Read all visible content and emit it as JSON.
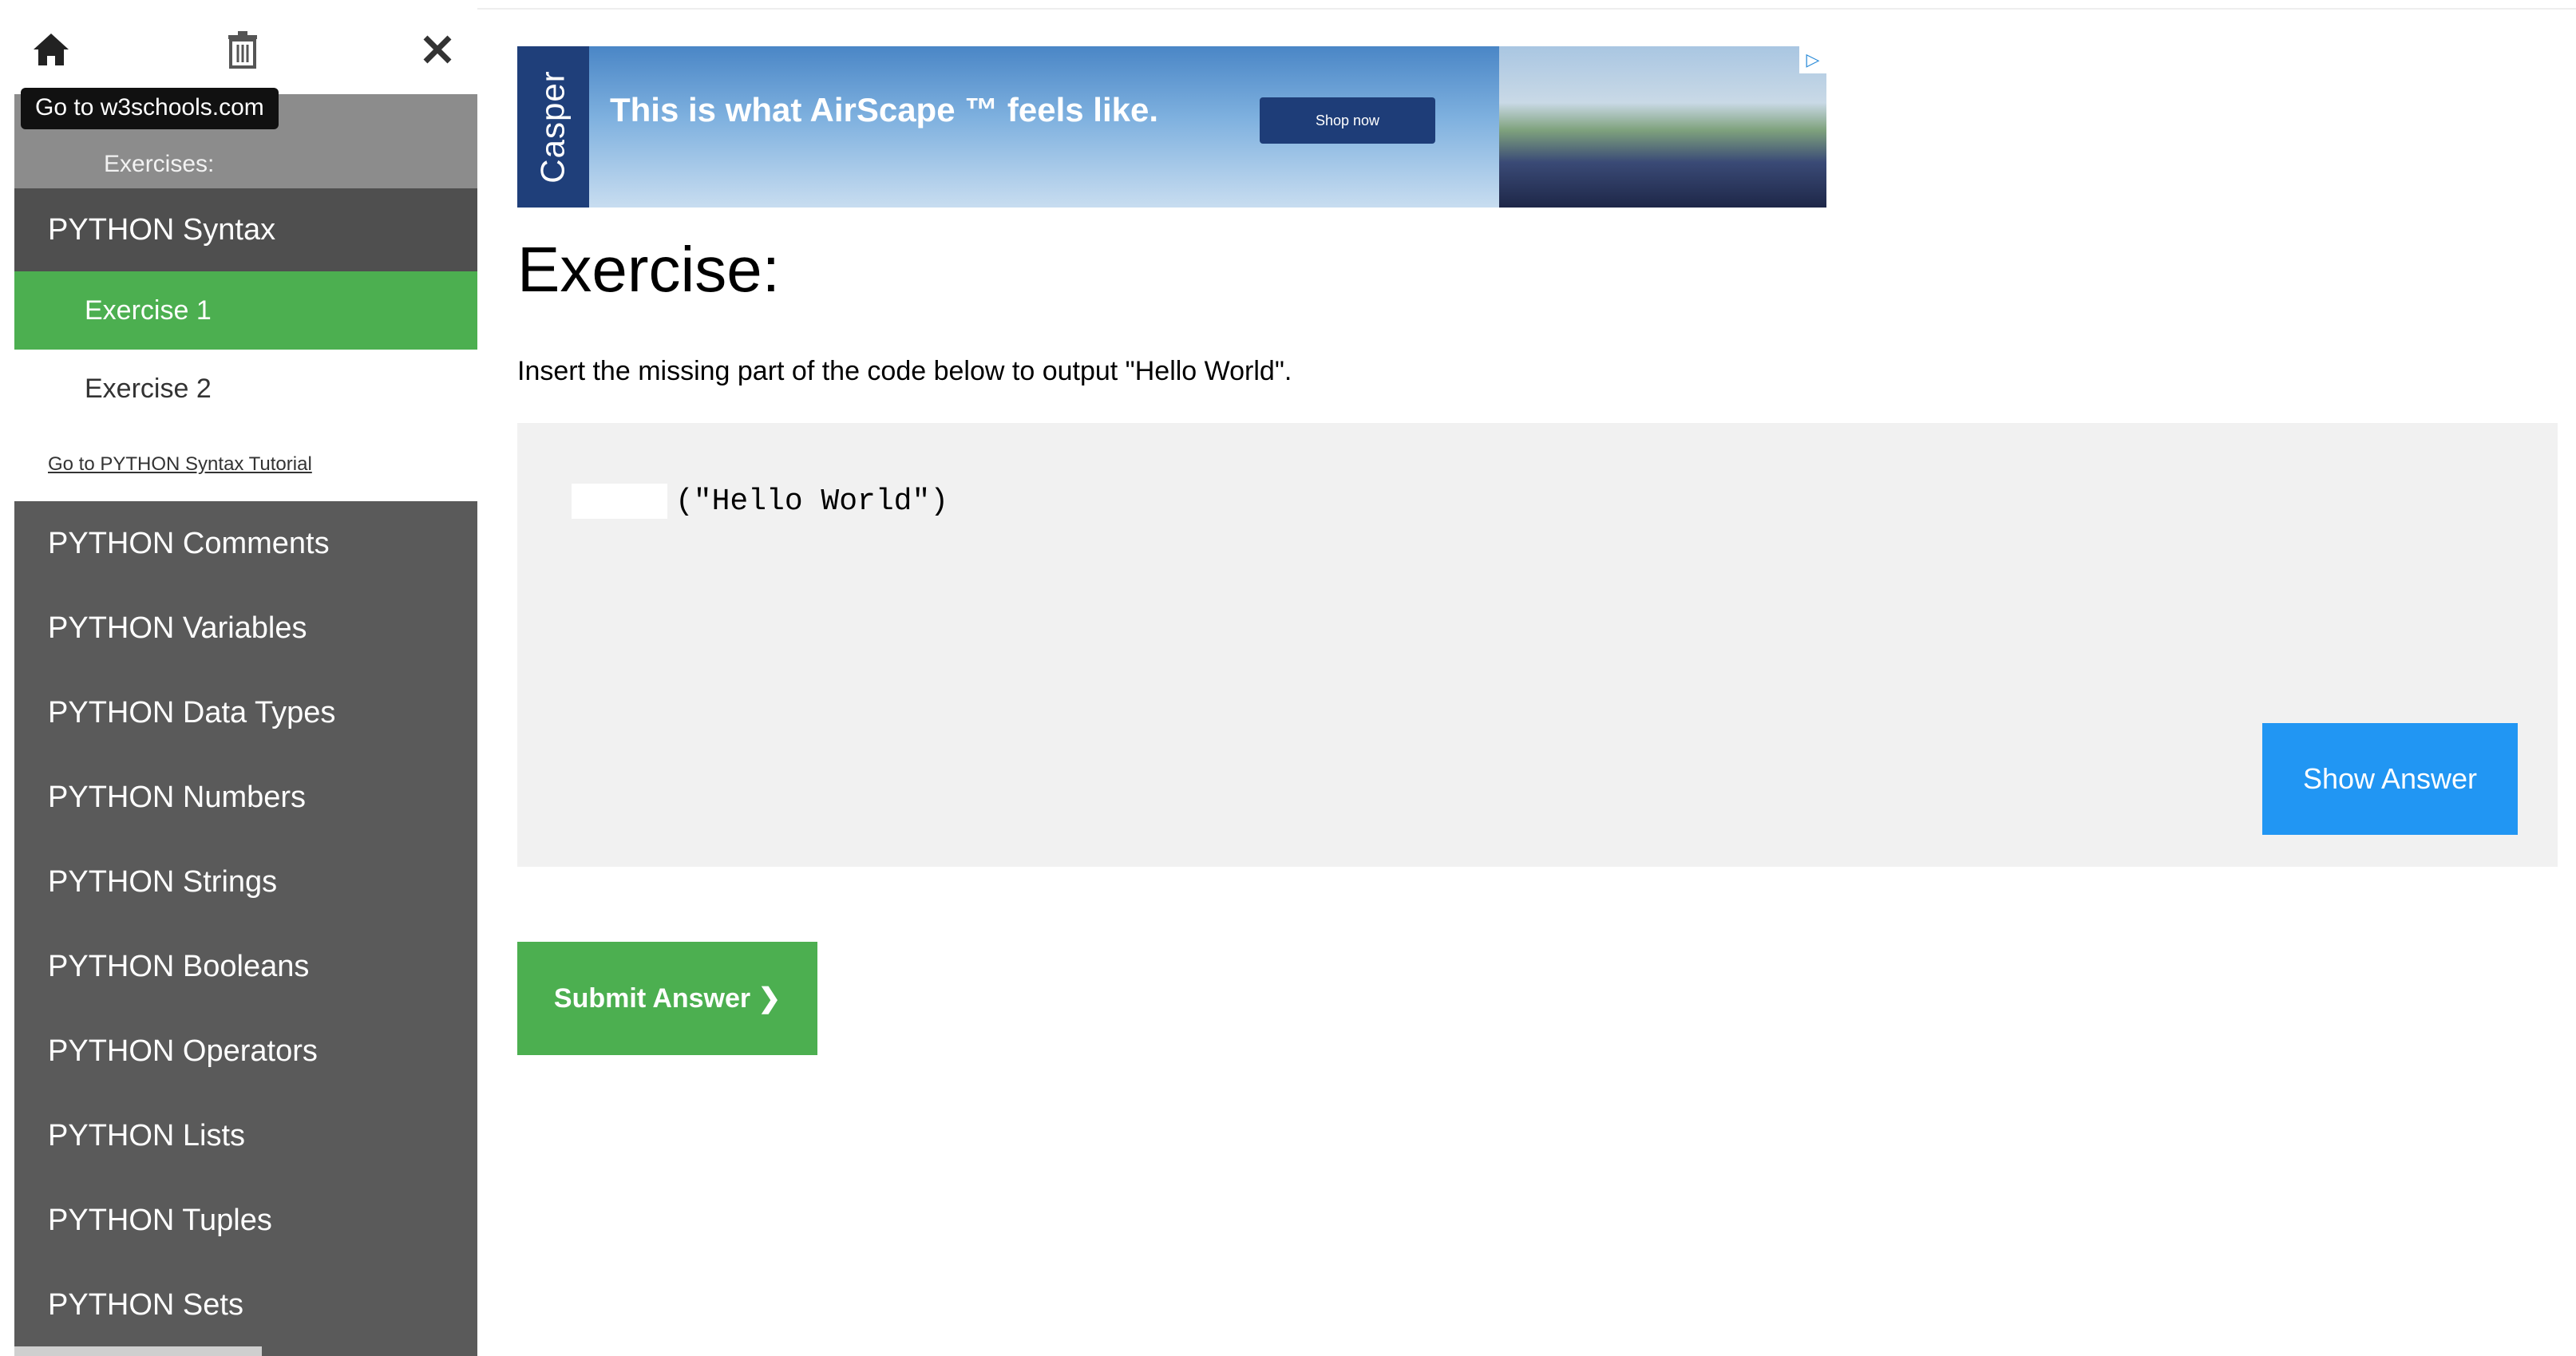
{
  "sidebar": {
    "tooltip": "Go to w3schools.com",
    "header": "Exercises:",
    "items": [
      {
        "label": "PYTHON Syntax"
      },
      {
        "label": "PYTHON Comments"
      },
      {
        "label": "PYTHON Variables"
      },
      {
        "label": "PYTHON Data Types"
      },
      {
        "label": "PYTHON Numbers"
      },
      {
        "label": "PYTHON Strings"
      },
      {
        "label": "PYTHON Booleans"
      },
      {
        "label": "PYTHON Operators"
      },
      {
        "label": "PYTHON Lists"
      },
      {
        "label": "PYTHON Tuples"
      },
      {
        "label": "PYTHON Sets"
      }
    ],
    "sub_items": [
      {
        "label": "Exercise 1",
        "active": true
      },
      {
        "label": "Exercise 2",
        "active": false
      }
    ],
    "tutorial_link": "Go to PYTHON Syntax Tutorial"
  },
  "ad": {
    "brand": "Casper",
    "headline": "This is what AirScape ™ feels like.",
    "cta": "Shop now"
  },
  "main": {
    "title": "Exercise:",
    "instruction": "Insert the missing part of the code below to output \"Hello World\".",
    "code_suffix": "(\"Hello World\")",
    "code_input_value": "",
    "show_answer_label": "Show Answer",
    "submit_label": "Submit Answer ❯"
  },
  "colors": {
    "sidebar_bg": "#5a5a5a",
    "active_green": "#4caf50",
    "show_answer_blue": "#2196f3",
    "code_panel_bg": "#f1f1f1"
  },
  "icons": [
    "home-icon",
    "trash-icon",
    "close-icon"
  ]
}
